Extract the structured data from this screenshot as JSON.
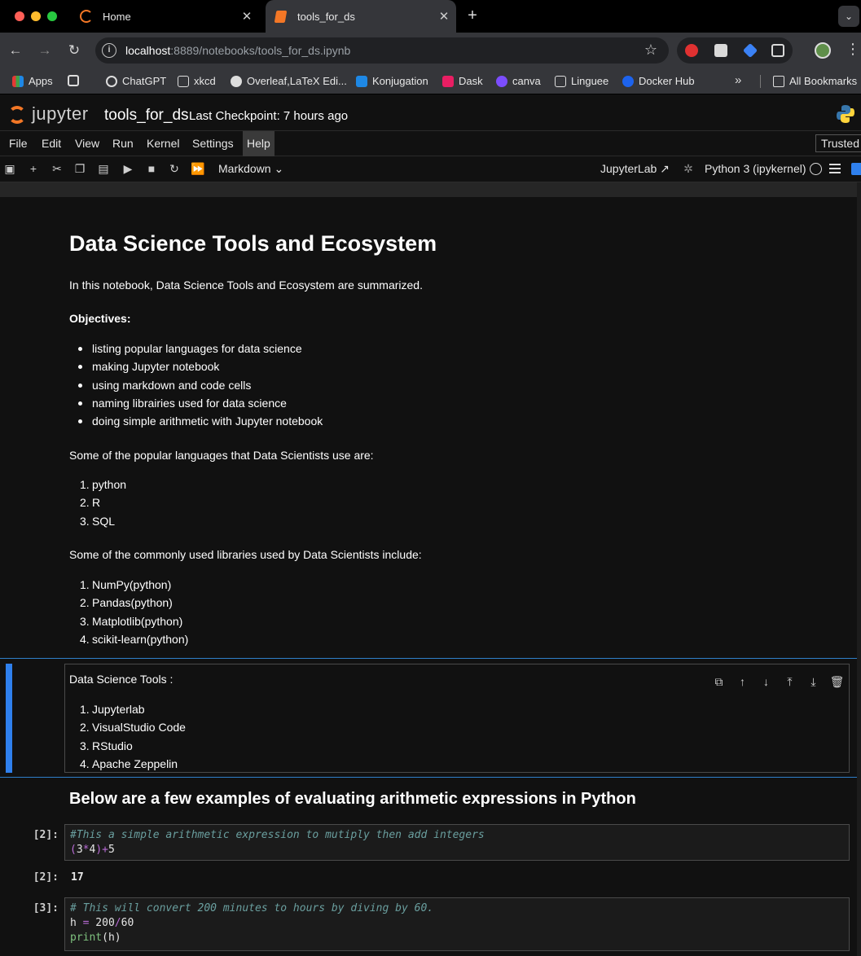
{
  "browser": {
    "tabs": [
      {
        "label": "Home"
      },
      {
        "label": "tools_for_ds"
      }
    ],
    "url_host": "localhost",
    "url_rest": ":8889/notebooks/tools_for_ds.ipynb",
    "bookmarks": [
      "Apps",
      "ChatGPT",
      "xkcd",
      "Overleaf,LaTeX Edi...",
      "Konjugation",
      "Dask",
      "canva",
      "Linguee",
      "Docker Hub",
      "All Bookmarks"
    ]
  },
  "jupyter": {
    "logo_text": "jupyter",
    "notebook_title": "tools_for_ds",
    "checkpoint": "Last Checkpoint: 7 hours ago",
    "menu": [
      "File",
      "Edit",
      "View",
      "Run",
      "Kernel",
      "Settings",
      "Help"
    ],
    "trusted": "Trusted",
    "toolbar": {
      "cell_type": "Markdown",
      "jupyterlab": "JupyterLab",
      "kernel": "Python 3 (ipykernel)"
    }
  },
  "notebook": {
    "heading": "Data Science Tools and Ecosystem",
    "intro": "In this notebook, Data Science Tools and Ecosystem are summarized.",
    "objectives_label": "Objectives:",
    "objectives": [
      "listing popular languages for data science",
      "making Jupyter notebook",
      "using markdown and code cells",
      "naming librairies used for data science",
      "doing simple arithmetic with Jupyter notebook"
    ],
    "languages_intro": "Some of the popular languages that Data Scientists use are:",
    "languages": [
      "python",
      "R",
      "SQL"
    ],
    "libraries_intro": "Some of the commonly used libraries used by Data Scientists include:",
    "libraries": [
      "NumPy(python)",
      "Pandas(python)",
      "Matplotlib(python)",
      "scikit-learn(python)"
    ],
    "tools_intro": "Data Science Tools :",
    "tools": [
      "Jupyterlab",
      "VisualStudio Code",
      "RStudio",
      "Apache Zeppelin"
    ],
    "arith_heading": "Below are a few examples of evaluating arithmetic expressions in Python",
    "cells": [
      {
        "prompt": "[2]:",
        "comment": "#This a simple arithmetic expression to mutiply then add integers",
        "output_prompt": "[2]:",
        "output": "17"
      },
      {
        "prompt": "[3]:",
        "comment": "# This will convert 200 minutes to hours by diving by 60."
      }
    ]
  }
}
